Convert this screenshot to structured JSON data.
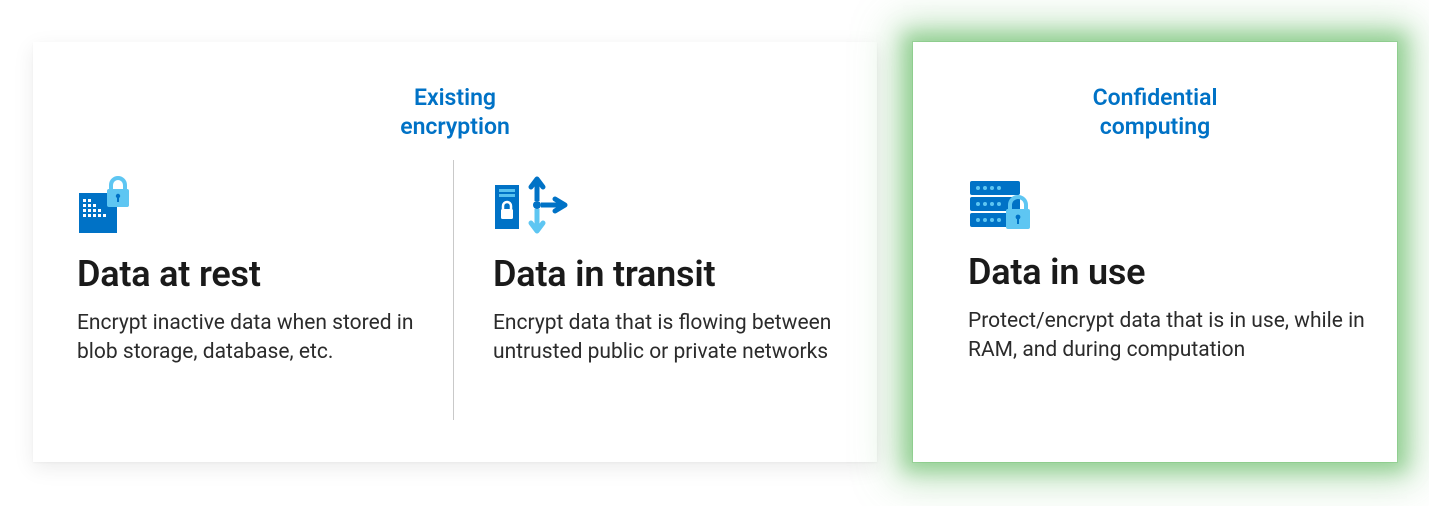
{
  "categories": {
    "existing": "Existing\nencryption",
    "confidential": "Confidential\ncomputing"
  },
  "states": {
    "at_rest": {
      "icon": "storage-lock-icon",
      "title": "Data at rest",
      "desc": "Encrypt inactive data when stored in blob storage, database, etc."
    },
    "in_transit": {
      "icon": "server-arrows-icon",
      "title": "Data in transit",
      "desc": "Encrypt data that is flowing between untrusted public or private networks"
    },
    "in_use": {
      "icon": "server-lock-icon",
      "title": "Data in use",
      "desc": "Protect/encrypt data that is in use, while in RAM, and during computation"
    }
  },
  "colors": {
    "accent_blue": "#0072C6",
    "highlight_green": "#7ac77a",
    "icon_dark": "#0072C6",
    "icon_light": "#5ec6f2"
  }
}
